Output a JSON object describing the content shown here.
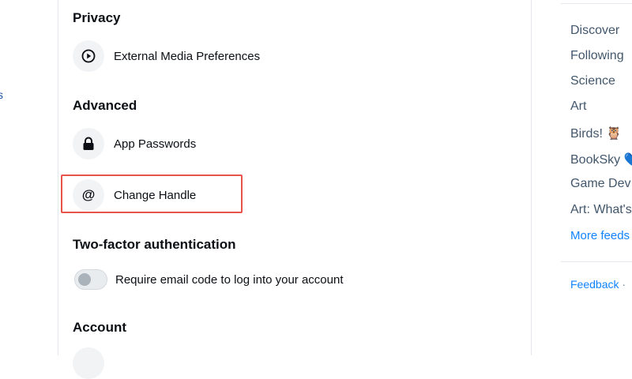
{
  "settings": {
    "privacy": {
      "title": "Privacy",
      "external_media": "External Media Preferences"
    },
    "advanced": {
      "title": "Advanced",
      "app_passwords": "App Passwords",
      "change_handle": "Change Handle"
    },
    "two_factor": {
      "title": "Two-factor authentication",
      "email_code_label": "Require email code to log into your account",
      "email_code_enabled": false
    },
    "account": {
      "title": "Account"
    }
  },
  "right_sidebar": {
    "feeds": [
      {
        "label": "Discover"
      },
      {
        "label": "Following"
      },
      {
        "label": "Science"
      },
      {
        "label": "Art"
      },
      {
        "label": "Birds! 🦉"
      },
      {
        "label": "BookSky 💙"
      },
      {
        "label": "Game Dev"
      },
      {
        "label": "Art: What's"
      }
    ],
    "more_feeds": "More feeds",
    "footer": {
      "feedback": "Feedback",
      "separator": "·"
    }
  },
  "colors": {
    "highlight_border": "#e8544a",
    "link": "#1083fe",
    "feed_text": "#42576c"
  }
}
